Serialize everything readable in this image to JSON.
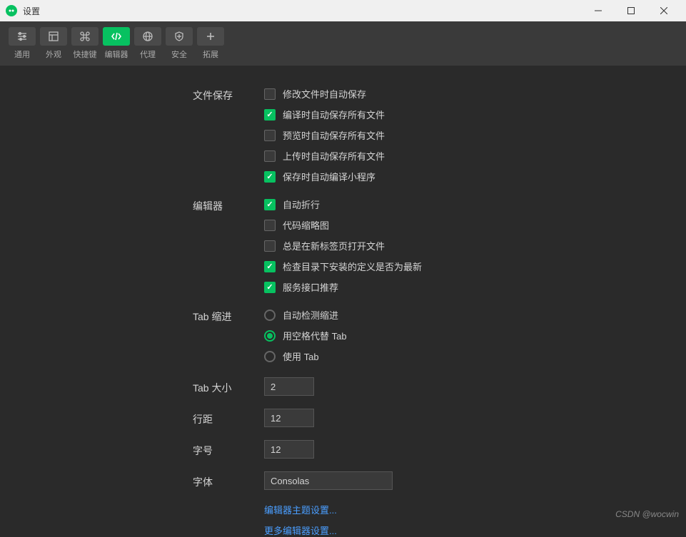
{
  "window": {
    "title": "设置"
  },
  "toolbar": {
    "items": [
      {
        "label": "通用"
      },
      {
        "label": "外观"
      },
      {
        "label": "快捷键"
      },
      {
        "label": "编辑器"
      },
      {
        "label": "代理"
      },
      {
        "label": "安全"
      },
      {
        "label": "拓展"
      }
    ]
  },
  "sections": {
    "fileSave": {
      "label": "文件保存",
      "options": [
        {
          "label": "修改文件时自动保存",
          "checked": false
        },
        {
          "label": "编译时自动保存所有文件",
          "checked": true
        },
        {
          "label": "预览时自动保存所有文件",
          "checked": false
        },
        {
          "label": "上传时自动保存所有文件",
          "checked": false
        },
        {
          "label": "保存时自动编译小程序",
          "checked": true
        }
      ]
    },
    "editor": {
      "label": "编辑器",
      "options": [
        {
          "label": "自动折行",
          "checked": true
        },
        {
          "label": "代码缩略图",
          "checked": false
        },
        {
          "label": "总是在新标签页打开文件",
          "checked": false
        },
        {
          "label": "检查目录下安装的定义是否为最新",
          "checked": true
        },
        {
          "label": "服务接口推荐",
          "checked": true
        }
      ]
    },
    "tabIndent": {
      "label": "Tab 缩进",
      "options": [
        {
          "label": "自动检测缩进",
          "checked": false
        },
        {
          "label": "用空格代替 Tab",
          "checked": true
        },
        {
          "label": "使用 Tab",
          "checked": false
        }
      ]
    },
    "tabSize": {
      "label": "Tab 大小",
      "value": "2"
    },
    "lineHeight": {
      "label": "行距",
      "value": "12"
    },
    "fontSize": {
      "label": "字号",
      "value": "12"
    },
    "fontFamily": {
      "label": "字体",
      "value": "Consolas"
    }
  },
  "links": {
    "themeSettings": "编辑器主题设置...",
    "moreSettings": "更多编辑器设置..."
  },
  "watermark": "CSDN @wocwin"
}
